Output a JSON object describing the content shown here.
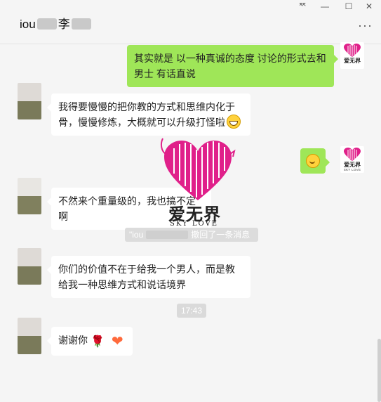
{
  "header": {
    "contact_name_prefix": "iou",
    "contact_name_suffix": "李",
    "window_controls": {
      "pin": "ᅑ",
      "minimize": "—",
      "maximize": "☐",
      "close": "✕"
    },
    "more_icon": "···"
  },
  "messages": [
    {
      "id": "m1",
      "side": "out",
      "text": "其实就是 以一种真诚的态度 讨论的形式去和男士 有话直说"
    },
    {
      "id": "m2",
      "side": "in",
      "text": "我得要慢慢的把你教的方式和思维内化于骨，慢慢修炼，大概就可以升级打怪啦"
    },
    {
      "id": "m3",
      "side": "out",
      "text": ""
    },
    {
      "id": "m4",
      "side": "in",
      "text": "不然来个重量级的，我也搞不定啊"
    },
    {
      "id": "m5",
      "side": "in",
      "text": "你们的价值不在于给我一个男人，而是教给我一种思维方式和说话境界"
    },
    {
      "id": "m6",
      "side": "in",
      "text": "谢谢你"
    }
  ],
  "system": {
    "recall_prefix": "\"iou",
    "recall_suffix": "撤回了一条消息",
    "timestamp": "17:43"
  },
  "brand": {
    "name": "爱无界",
    "slogan": "SKY LOVE",
    "color": "#e0208a"
  },
  "colors": {
    "outgoing_bubble": "#9fe658",
    "incoming_bubble": "#ffffff",
    "background": "#f5f5f5"
  }
}
